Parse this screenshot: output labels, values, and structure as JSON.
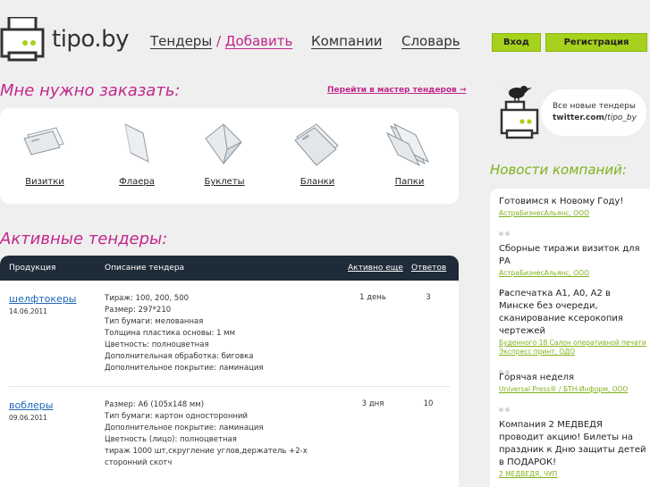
{
  "header": {
    "logo_text": "tipo",
    "logo_domain": ".by",
    "nav": {
      "tenders": "Тендеры",
      "slash": "/",
      "add": "Добавить",
      "companies": "Компании",
      "dictionary": "Словарь"
    },
    "login_label": "Вход",
    "register_label": "Регистрация"
  },
  "order": {
    "heading": "Мне нужно заказать:",
    "master_link": "Перейти в мастер тендеров →",
    "items": [
      {
        "label": "Визитки",
        "icon": "business-cards-icon"
      },
      {
        "label": "Флаера",
        "icon": "flyer-icon"
      },
      {
        "label": "Буклеты",
        "icon": "booklet-icon"
      },
      {
        "label": "Бланки",
        "icon": "letterhead-icon"
      },
      {
        "label": "Папки",
        "icon": "folder-icon"
      }
    ]
  },
  "tenders": {
    "heading": "Активные тендеры:",
    "columns": {
      "product": "Продукция",
      "description": "Описание тендера",
      "active": "Активно еще",
      "answers": "Ответов"
    },
    "rows": [
      {
        "product": "шелфтокеры",
        "date": "14.06.2011",
        "description": "Тираж: 100, 200, 500\nРазмер: 297*210\nТип бумаги: мелованная\nТолщина пластика основы: 1 мм\nЦветность: полноцветная\nДополнительная обработка: биговка\nДополнительное покрытие: ламинация",
        "active": "1 день",
        "answers": "3"
      },
      {
        "product": "воблеры",
        "date": "09.06.2011",
        "description": "Размер: А6 (105х148 мм)\nТип бумаги: картон односторонний\nДополнительное покрытие: ламинация\nЦветность (лицо): полноцветная\nтираж 1000 шт,скругление углов,держатель +2-х сторонний скотч",
        "active": "3 дня",
        "answers": "10"
      }
    ]
  },
  "twitter": {
    "line1": "Все новые тендеры",
    "line2_bold": "twitter.com/",
    "line2_italic": "tipo_by"
  },
  "news": {
    "heading": "Новости компаний:",
    "items": [
      {
        "title": "Готовимся к Новому Году!",
        "source": "АстраБизнесАльянс, ООО"
      },
      {
        "title": "Сборные тиражи визиток для РА",
        "source": "АстраБизнесАльянс, ООО"
      },
      {
        "title": "Распечатка А1, А0, А2 в Минске без очереди, сканирование ксерокопия чертежей",
        "source": "Буденного 18 Салон оперативной печати Экспресс принт, ОДО"
      },
      {
        "title": "Горячая неделя",
        "source": "Universal Press® / БТН-Информ, ООО"
      },
      {
        "title": "Компания 2 МЕДВЕДЯ проводит акцию! Билеты на праздник к Дню защиты детей в ПОДАРОК!",
        "source": "2 МЕДВЕДЯ, ЧУП"
      }
    ]
  },
  "colors": {
    "accent_pink": "#c2278b",
    "accent_green": "#a6d11c",
    "table_header": "#1e2b38",
    "link_blue": "#1d66b7"
  }
}
